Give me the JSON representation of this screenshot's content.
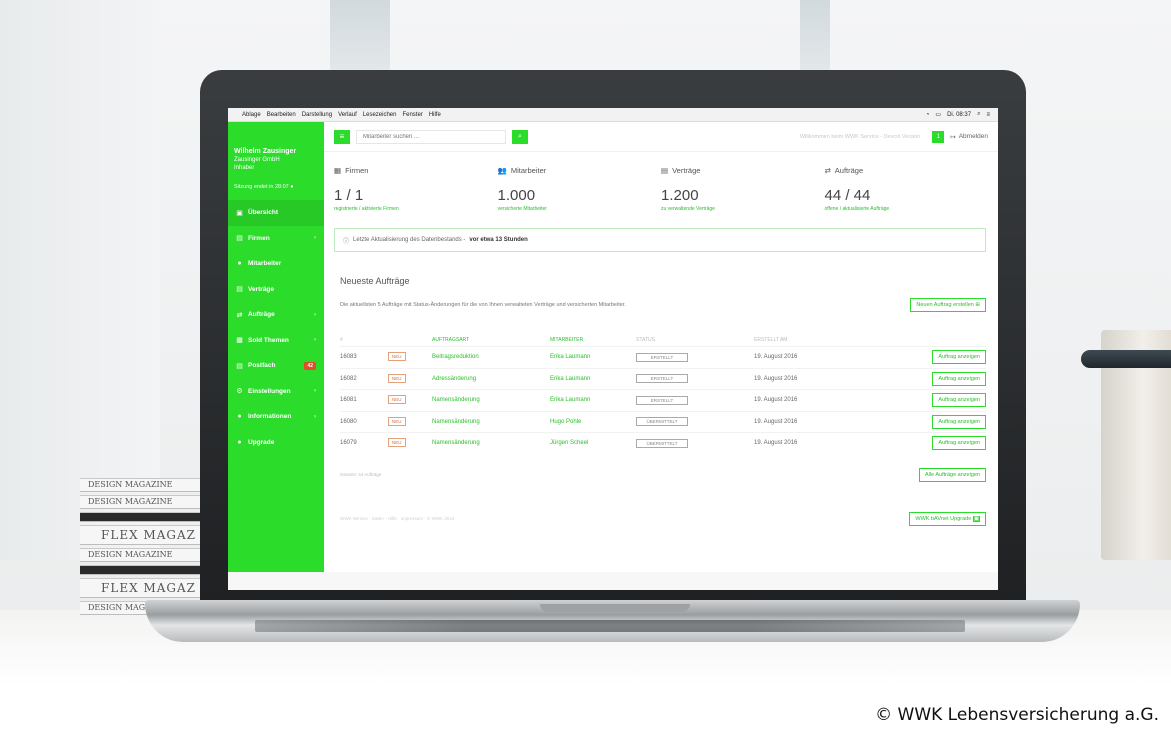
{
  "menubar": {
    "items": [
      "Ablage",
      "Bearbeiten",
      "Darstellung",
      "Verlauf",
      "Lesezeichen",
      "Fenster",
      "Hilfe"
    ],
    "right": "Di. 08:37"
  },
  "sidebar": {
    "user_name": "Wilhelm Zausinger",
    "company": "Zausinger GmbH",
    "role": "Inhaber",
    "session": "Sitzung endet in 28:07",
    "items": [
      {
        "label": "Übersicht",
        "icon": "monitor-icon",
        "glyph": "▣",
        "arrow": ""
      },
      {
        "label": "Firmen",
        "icon": "building-icon",
        "glyph": "▤",
        "arrow": "›"
      },
      {
        "label": "Mitarbeiter",
        "icon": "users-icon",
        "glyph": "●",
        "arrow": ""
      },
      {
        "label": "Verträge",
        "icon": "document-icon",
        "glyph": "▤",
        "arrow": ""
      },
      {
        "label": "Aufträge",
        "icon": "exchange-icon",
        "glyph": "⇄",
        "arrow": "›"
      },
      {
        "label": "Sold Themen",
        "icon": "grid-icon",
        "glyph": "▦",
        "arrow": "›"
      },
      {
        "label": "Postfach",
        "icon": "inbox-icon",
        "glyph": "▤",
        "badge": "42"
      },
      {
        "label": "Einstellungen",
        "icon": "settings-icon",
        "glyph": "⚙",
        "arrow": "›"
      },
      {
        "label": "Informationen",
        "icon": "info-icon",
        "glyph": "●",
        "arrow": "›"
      },
      {
        "label": "Upgrade",
        "icon": "upgrade-icon",
        "glyph": "●",
        "arrow": ""
      }
    ]
  },
  "topbar": {
    "search_placeholder": "Mitarbeiter suchen ...",
    "welcome": "Willkommen beim WWK Service - Devcol Version",
    "notif_count": "1",
    "logout": "Abmelden"
  },
  "stats": [
    {
      "title": "Firmen",
      "icon": "building-icon",
      "glyph": "▦",
      "value": "1 / 1",
      "sub": "registrierte / aktivierte Firmen"
    },
    {
      "title": "Mitarbeiter",
      "icon": "users-icon",
      "glyph": "👥",
      "value": "1.000",
      "sub": "versicherte Mitarbeiter"
    },
    {
      "title": "Verträge",
      "icon": "document-icon",
      "glyph": "▤",
      "value": "1.200",
      "sub": "zu verwaltende Verträge"
    },
    {
      "title": "Aufträge",
      "icon": "exchange-icon",
      "glyph": "⇄",
      "value": "44 / 44",
      "sub": "offene / aktualisierte Aufträge"
    }
  ],
  "alert": {
    "text": "Letzte Aktualisierung des Datenbestands - ",
    "bold": "vor etwa 13 Stunden"
  },
  "orders": {
    "title": "Neueste Aufträge",
    "desc": "Die aktuellsten 5 Aufträge mit Status-Änderungen für die von Ihnen verwalteten Verträge und versicherten Mitarbeiter.",
    "new_button": "Neuen Auftrag erstellen",
    "headers": [
      "#",
      "",
      "AUFTRAGSART",
      "MITARBEITER",
      "STATUS",
      "ERSTELLT AM",
      ""
    ],
    "rows": [
      {
        "id": "16083",
        "tag": "NEU",
        "type": "Beitragsreduktion",
        "employee": "Erika Laumann",
        "status": "ERSTELLT",
        "date": "19. August 2016",
        "action": "Auftrag anzeigen"
      },
      {
        "id": "16082",
        "tag": "NEU",
        "type": "Adressänderung",
        "employee": "Erika Laumann",
        "status": "ERSTELLT",
        "date": "19. August 2016",
        "action": "Auftrag anzeigen"
      },
      {
        "id": "16081",
        "tag": "NEU",
        "type": "Namensänderung",
        "employee": "Erika Laumann",
        "status": "ERSTELLT",
        "date": "19. August 2016",
        "action": "Auftrag anzeigen"
      },
      {
        "id": "16080",
        "tag": "NEU",
        "type": "Namensänderung",
        "employee": "Hugo Pohle",
        "status": "ÜBERMITTELT",
        "date": "19. August 2016",
        "action": "Auftrag anzeigen"
      },
      {
        "id": "16079",
        "tag": "NEU",
        "type": "Namensänderung",
        "employee": "Jürgen Scheel",
        "status": "ÜBERMITTELT",
        "date": "19. August 2016",
        "action": "Auftrag anzeigen"
      }
    ],
    "count": "Gesamt: 44 Aufträge",
    "all_button": "Alle Aufträge anzeigen"
  },
  "footer": {
    "copy": "WWK Service · Daten · Hilfe · Impressum · © WWK 2016",
    "upgrade_button": "WWK bAVnet Upgrade"
  },
  "credit": "© WWK Lebensversicherung a.G.",
  "books": [
    "DESIGN MAGAZINE",
    "DESIGN MAGAZINE",
    "FLEX MAGAZ",
    "DESIGN MAGAZINE",
    "FLEX MAGAZ",
    "DESIGN MAGAZINE"
  ],
  "colors": {
    "accent": "#2bdc2b",
    "badge": "#e34c2a",
    "tag_new": "#d0703d"
  }
}
